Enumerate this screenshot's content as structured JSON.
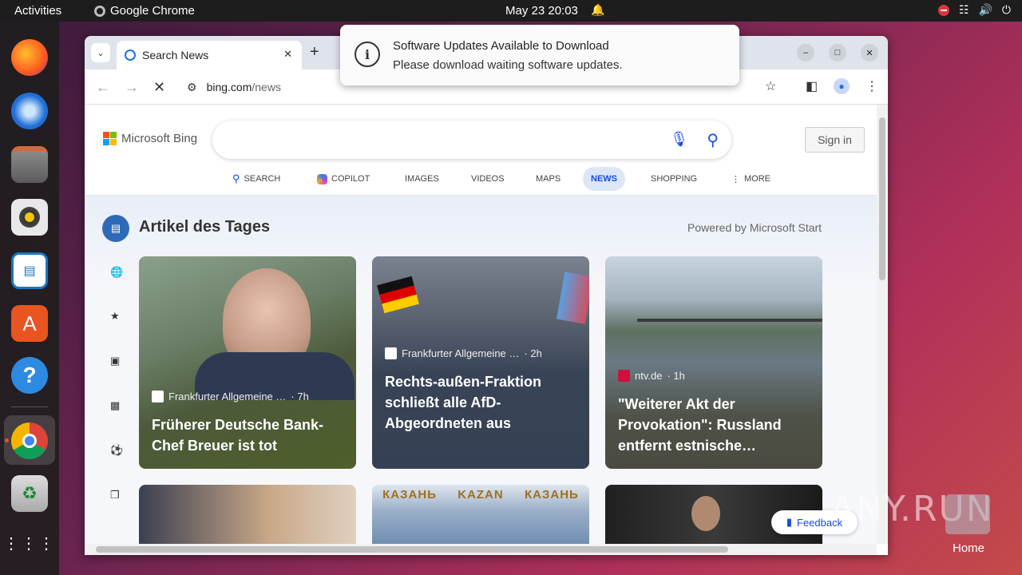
{
  "topbar": {
    "activities": "Activities",
    "app_name": "Google Chrome",
    "datetime": "May 23  20:03"
  },
  "dock": {
    "apps": [
      "firefox-icon",
      "thunderbird-icon",
      "files-icon",
      "rhythmbox-icon",
      "writer-icon",
      "app-center-icon",
      "help-icon",
      "chrome-icon",
      "trash-icon",
      "app-grid-icon"
    ]
  },
  "browser": {
    "tab_title": "Search News",
    "url_host": "bing.com",
    "url_path": "/news"
  },
  "bing": {
    "logo_text": "Microsoft Bing",
    "signin": "Sign in",
    "nav": [
      "SEARCH",
      "COPILOT",
      "IMAGES",
      "VIDEOS",
      "MAPS",
      "NEWS",
      "SHOPPING",
      "MORE"
    ],
    "section_title": "Artikel des Tages",
    "powered": "Powered by Microsoft Start",
    "feedback": "Feedback",
    "cards": [
      {
        "source": "Frankfurter Allgemeine …",
        "age": "· 7h",
        "headline": "Früherer Deutsche Bank-Chef Breuer ist tot"
      },
      {
        "source": "Frankfurter Allgemeine …",
        "age": "· 2h",
        "headline": "Rechts-außen-Fraktion schließt alle AfD-Abgeordneten aus"
      },
      {
        "source": "ntv.de",
        "age": "· 1h",
        "headline": "\"Weiterer Akt der Provokation\": Russland entfernt estnische…"
      }
    ],
    "card2_signs": [
      "КАЗАНЬ",
      "KAZAN",
      "КАЗАНЬ"
    ]
  },
  "notification": {
    "title": "Software Updates Available to Download",
    "body": "Please download waiting software updates."
  },
  "desktop": {
    "home_label": "Home",
    "watermark": "ANY.RUN"
  }
}
